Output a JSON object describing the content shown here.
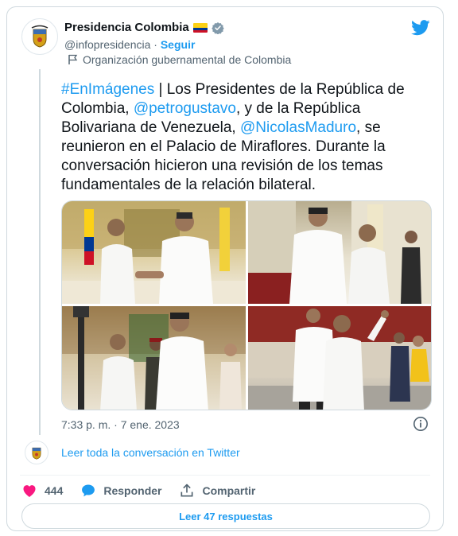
{
  "author": {
    "name": "Presidencia Colombia",
    "handle": "@infopresidencia",
    "separator": " · ",
    "follow_label": "Seguir",
    "org_label": "Organización gubernamental de Colombia"
  },
  "tweet": {
    "hashtag": "#EnImágenes",
    "text_1": " | Los Presidentes de la República de Colombia, ",
    "mention_1": "@petrogustavo",
    "text_2": ", y de la República Bolivariana de Venezuela, ",
    "mention_2": "@NicolasMaduro",
    "text_3": ", se reunieron en el Palacio de Miraflores. Durante la conversación hicieron una revisión de los temas fundamentales de la relación bilateral.",
    "timestamp": "7:33 p. m. · 7 ene. 2023"
  },
  "conversation_link": "Leer toda la conversación en Twitter",
  "actions": {
    "likes": "444",
    "reply_label": "Responder",
    "share_label": "Compartir"
  },
  "replies_button": "Leer 47 respuestas",
  "colors": {
    "accent": "#1d9bf0",
    "like": "#f91880",
    "text": "#0f1419",
    "muted": "#536471"
  },
  "icons": [
    "twitter-logo-icon",
    "verified-badge-icon",
    "flag-icon",
    "info-icon",
    "heart-icon",
    "reply-bubble-icon",
    "share-icon",
    "coat-of-arms-icon"
  ]
}
